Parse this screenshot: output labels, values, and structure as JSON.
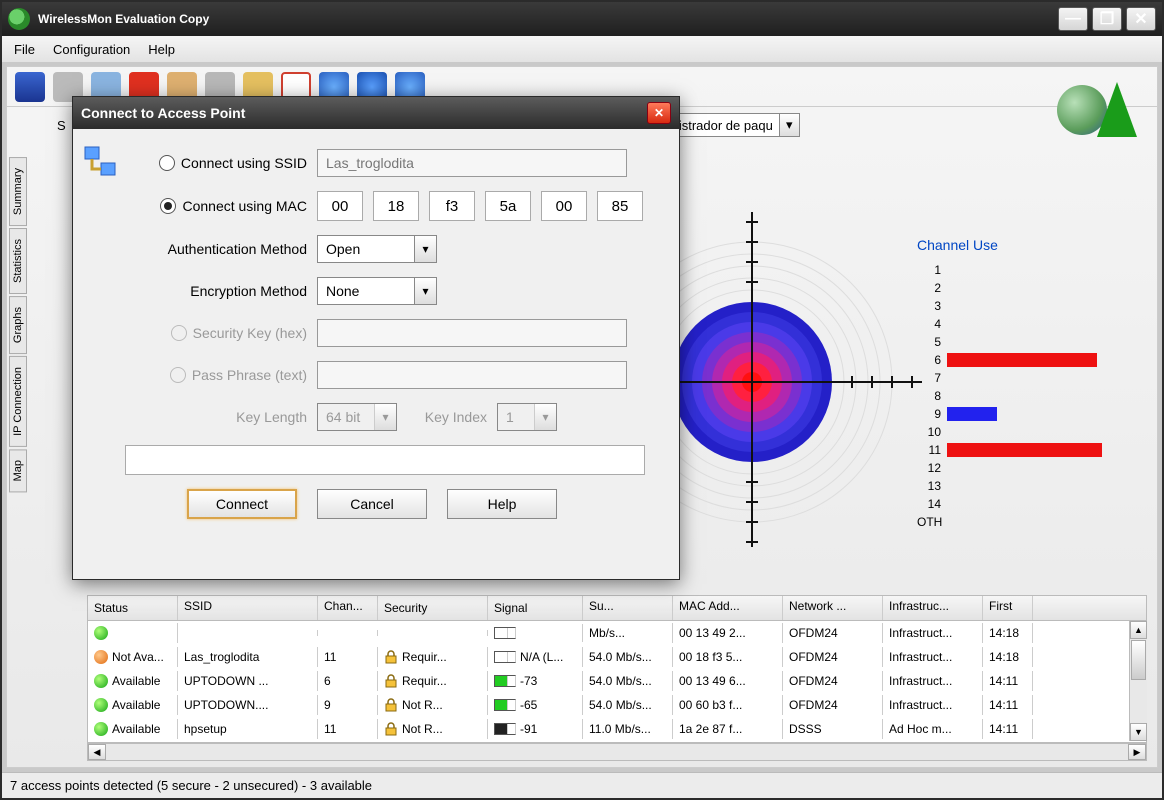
{
  "app": {
    "title": "WirelessMon Evaluation Copy"
  },
  "menu": {
    "file": "File",
    "config": "Configuration",
    "help": "Help"
  },
  "adapter_select_visible": "dministrador de paqu",
  "vertical_tabs": [
    "Summary",
    "Statistics",
    "Graphs",
    "IP Connection",
    "Map"
  ],
  "channel_use": {
    "title": "Channel Use",
    "rows": [
      {
        "label": "1",
        "width": 0,
        "cls": ""
      },
      {
        "label": "2",
        "width": 0,
        "cls": ""
      },
      {
        "label": "3",
        "width": 0,
        "cls": ""
      },
      {
        "label": "4",
        "width": 0,
        "cls": ""
      },
      {
        "label": "5",
        "width": 0,
        "cls": ""
      },
      {
        "label": "6",
        "width": 150,
        "cls": "red"
      },
      {
        "label": "7",
        "width": 0,
        "cls": ""
      },
      {
        "label": "8",
        "width": 0,
        "cls": ""
      },
      {
        "label": "9",
        "width": 50,
        "cls": "blue"
      },
      {
        "label": "10",
        "width": 0,
        "cls": ""
      },
      {
        "label": "11",
        "width": 155,
        "cls": "red"
      },
      {
        "label": "12",
        "width": 0,
        "cls": ""
      },
      {
        "label": "13",
        "width": 0,
        "cls": ""
      },
      {
        "label": "14",
        "width": 0,
        "cls": ""
      },
      {
        "label": "OTH",
        "width": 0,
        "cls": ""
      }
    ]
  },
  "table": {
    "headers": [
      "Status",
      "SSID",
      "Chan...",
      "Security",
      "Signal",
      "Su...",
      "MAC Add...",
      "Network ...",
      "Infrastruc...",
      "First"
    ],
    "rows": [
      {
        "dot": "green",
        "status": "",
        "ssid": "",
        "ch": "",
        "sec": "",
        "sig": {
          "fill": "",
          "w": 0
        },
        "sigtxt": "",
        "rate": "Mb/s...",
        "mac": "00 13 49 2...",
        "net": "OFDM24",
        "inf": "Infrastruct...",
        "first": "14:18"
      },
      {
        "dot": "orange",
        "status": "Not Ava...",
        "ssid": "Las_troglodita",
        "ch": "11",
        "sec": "Requir...",
        "sig": {
          "fill": "",
          "w": 0
        },
        "sigtxt": "N/A (L...",
        "rate": "54.0 Mb/s...",
        "mac": "00 18 f3 5...",
        "net": "OFDM24",
        "inf": "Infrastruct...",
        "first": "14:18"
      },
      {
        "dot": "green",
        "status": "Available",
        "ssid": "UPTODOWN ...",
        "ch": "6",
        "sec": "Requir...",
        "sig": {
          "fill": "green",
          "w": 8
        },
        "sigtxt": "-73",
        "rate": "54.0 Mb/s...",
        "mac": "00 13 49 6...",
        "net": "OFDM24",
        "inf": "Infrastruct...",
        "first": "14:11"
      },
      {
        "dot": "green",
        "status": "Available",
        "ssid": "UPTODOWN....",
        "ch": "9",
        "sec": "Not R...",
        "sig": {
          "fill": "green",
          "w": 10
        },
        "sigtxt": "-65",
        "rate": "54.0 Mb/s...",
        "mac": "00 60 b3 f...",
        "net": "OFDM24",
        "inf": "Infrastruct...",
        "first": "14:11"
      },
      {
        "dot": "green",
        "status": "Available",
        "ssid": "hpsetup",
        "ch": "11",
        "sec": "Not R...",
        "sig": {
          "fill": "black",
          "w": 4
        },
        "sigtxt": "-91",
        "rate": "11.0 Mb/s...",
        "mac": "1a 2e 87 f...",
        "net": "DSSS",
        "inf": "Ad Hoc m...",
        "first": "14:11"
      }
    ]
  },
  "status": "7 access points detected (5 secure - 2 unsecured) - 3 available",
  "dialog": {
    "title": "Connect to Access Point",
    "ssid_label": "Connect using SSID",
    "ssid_value": "Las_troglodita",
    "mac_label": "Connect using MAC",
    "mac": [
      "00",
      "18",
      "f3",
      "5a",
      "00",
      "85"
    ],
    "auth_label": "Authentication Method",
    "auth_value": "Open",
    "enc_label": "Encryption Method",
    "enc_value": "None",
    "seckey_label": "Security Key (hex)",
    "pass_label": "Pass Phrase (text)",
    "keylen_label": "Key Length",
    "keylen_value": "64 bit",
    "keyidx_label": "Key Index",
    "keyidx_value": "1",
    "btn_connect": "Connect",
    "btn_cancel": "Cancel",
    "btn_help": "Help"
  }
}
